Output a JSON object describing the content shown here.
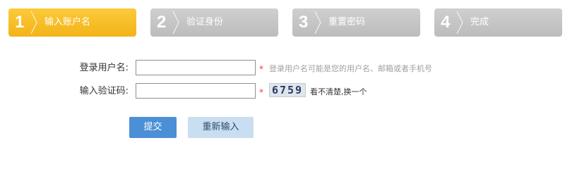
{
  "steps": [
    {
      "num": "1",
      "label": "输入账户名",
      "active": true
    },
    {
      "num": "2",
      "label": "验证身份",
      "active": false
    },
    {
      "num": "3",
      "label": "重置密码",
      "active": false
    },
    {
      "num": "4",
      "label": "完成",
      "active": false
    }
  ],
  "form": {
    "username": {
      "label": "登录用户名:",
      "value": "",
      "required_mark": "*",
      "hint": "登录用户名可能是您的用户名、邮箱或者手机号"
    },
    "captcha": {
      "label": "输入验证码:",
      "value": "",
      "required_mark": "*",
      "code": "6759",
      "refresh_text": "看不清楚,换一个"
    }
  },
  "buttons": {
    "submit": "提交",
    "reset": "重新输入"
  },
  "colors": {
    "active_step": "#f3b318",
    "inactive_step": "#c4c4c4",
    "primary_button": "#4b8fd6",
    "secondary_button": "#c9def1",
    "required_mark": "#e3393c"
  }
}
